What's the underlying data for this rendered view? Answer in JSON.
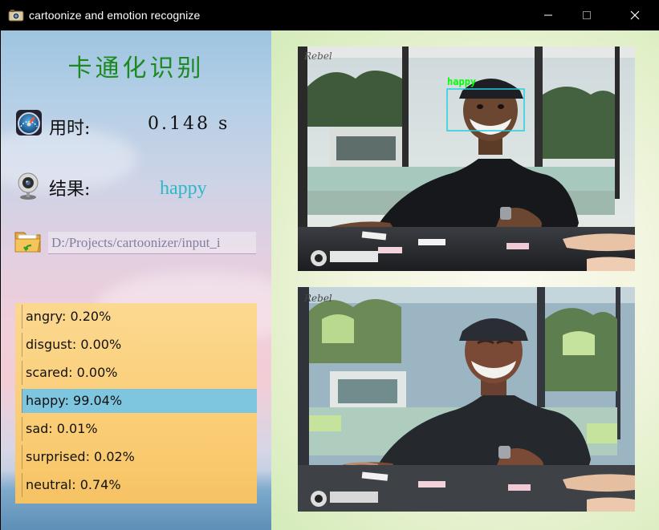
{
  "window": {
    "title": "cartoonize and emotion recognize",
    "icon": "camera-icon",
    "controls": [
      "minimize-icon",
      "maximize-icon",
      "close-icon"
    ]
  },
  "app": {
    "heading": "卡通化识别"
  },
  "timing": {
    "icon": "speedometer-icon",
    "label": "用时:",
    "value": "0.148 s"
  },
  "result": {
    "icon": "webcam-icon",
    "label": "结果:",
    "value": "happy"
  },
  "file": {
    "icon": "open-folder-icon",
    "path": "D:/Projects/cartoonizer/input_i"
  },
  "emotions": {
    "items": [
      {
        "label": "angry: 0.20%"
      },
      {
        "label": "disgust: 0.00%"
      },
      {
        "label": "scared: 0.00%"
      },
      {
        "label": "happy: 99.04%"
      },
      {
        "label": "sad: 0.01%"
      },
      {
        "label": "surprised: 0.02%"
      },
      {
        "label": "neutral: 0.74%"
      }
    ],
    "selected_index": 3
  },
  "images": {
    "original": {
      "face_box_label": "happy",
      "watermark": "Rebel"
    },
    "cartoon": {
      "watermark": "Rebel"
    }
  },
  "colors": {
    "heading": "#1c8a1f",
    "result": "#2cb8c8",
    "face_box": "#22d0e0",
    "face_label": "#00ff00",
    "selection": "#7ec6df"
  }
}
